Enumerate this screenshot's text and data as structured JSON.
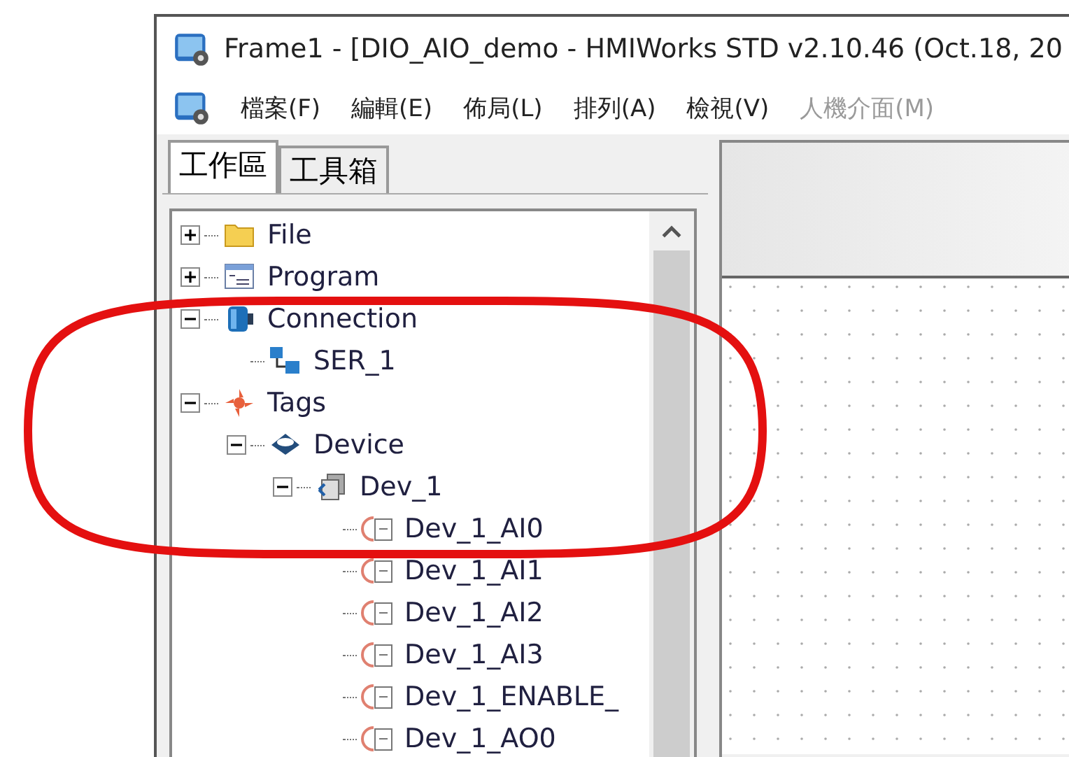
{
  "window": {
    "title": "Frame1 - [DIO_AIO_demo - HMIWorks STD v2.10.46 (Oct.18, 20"
  },
  "menu": [
    {
      "label": "檔案(F)",
      "disabled": false
    },
    {
      "label": "編輯(E)",
      "disabled": false
    },
    {
      "label": "佈局(L)",
      "disabled": false
    },
    {
      "label": "排列(A)",
      "disabled": false
    },
    {
      "label": "檢視(V)",
      "disabled": false
    },
    {
      "label": "人機介面(M)",
      "disabled": true
    }
  ],
  "tabs": [
    {
      "label": "工作區",
      "selected": true
    },
    {
      "label": "工具箱",
      "selected": false
    }
  ],
  "tree": [
    {
      "label": "File",
      "kind": "folder",
      "expanded": false
    },
    {
      "label": "Program",
      "kind": "program",
      "expanded": false
    },
    {
      "label": "Connection",
      "kind": "connection",
      "expanded": true,
      "children": [
        {
          "label": "SER_1",
          "kind": "link"
        }
      ]
    },
    {
      "label": "Tags",
      "kind": "tags",
      "expanded": true,
      "children": [
        {
          "label": "Device",
          "kind": "device",
          "expanded": true,
          "children": [
            {
              "label": "Dev_1",
              "kind": "dev",
              "expanded": true,
              "children": [
                {
                  "label": "Dev_1_AI0",
                  "kind": "tag"
                },
                {
                  "label": "Dev_1_AI1",
                  "kind": "tag"
                },
                {
                  "label": "Dev_1_AI2",
                  "kind": "tag"
                },
                {
                  "label": "Dev_1_AI3",
                  "kind": "tag"
                },
                {
                  "label": "Dev_1_ENABLE_",
                  "kind": "tag"
                },
                {
                  "label": "Dev_1_AO0",
                  "kind": "tag"
                }
              ]
            }
          ]
        }
      ]
    }
  ]
}
